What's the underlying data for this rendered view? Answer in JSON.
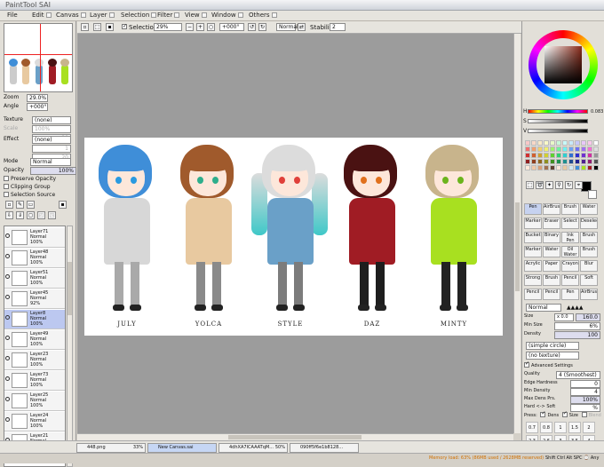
{
  "app": {
    "title": "PaintTool SAI"
  },
  "menu": [
    "File",
    "Edit",
    "Canvas",
    "Layer",
    "Selection",
    "Filter",
    "View",
    "Window",
    "Others"
  ],
  "navigator": {
    "zoom_label": "Zoom",
    "zoom_value": "29.0%",
    "angle_label": "Angle",
    "angle_value": "+000°"
  },
  "texture": {
    "label": "Texture",
    "value": "(none)",
    "scale_label": "Scale",
    "scale_value": "100%",
    "strength": "20"
  },
  "effect": {
    "label": "Effect",
    "value": "(none)",
    "width": "1",
    "strength": "20"
  },
  "layer_props": {
    "mode_label": "Mode",
    "mode_value": "Normal",
    "opacity_label": "Opacity",
    "opacity_value": "100%",
    "preserve": "Preserve Opacity",
    "clipping": "Clipping Group",
    "selection_source": "Selection Source"
  },
  "layers": [
    {
      "name": "Layer71",
      "mode": "Normal",
      "opacity": "100%"
    },
    {
      "name": "Layer48",
      "mode": "Normal",
      "opacity": "100%"
    },
    {
      "name": "Layer51",
      "mode": "Normal",
      "opacity": "100%"
    },
    {
      "name": "Layer45",
      "mode": "Normal",
      "opacity": "92%"
    },
    {
      "name": "Layer8",
      "mode": "Normal",
      "opacity": "100%"
    },
    {
      "name": "Layer49",
      "mode": "Normal",
      "opacity": "100%"
    },
    {
      "name": "Layer23",
      "mode": "Normal",
      "opacity": "100%"
    },
    {
      "name": "Layer73",
      "mode": "Normal",
      "opacity": "100%"
    },
    {
      "name": "Layer25",
      "mode": "Normal",
      "opacity": "100%"
    },
    {
      "name": "Layer24",
      "mode": "Normal",
      "opacity": "100%"
    },
    {
      "name": "Layer21",
      "mode": "Normal",
      "opacity": "100%"
    }
  ],
  "toolbar": {
    "selection_label": "Selection",
    "zoom": "29%",
    "angle": "+000°",
    "blend": "Normal",
    "stabilizer_label": "Stabilizer",
    "stabilizer_value": "2"
  },
  "characters": [
    {
      "name": "JULY",
      "hair": "#3f8ed8",
      "eyes": "#2a9ae0",
      "top": "#d7d7d7",
      "legs": "#a9a9a9"
    },
    {
      "name": "YOLCA",
      "hair": "#a05a2c",
      "eyes": "#2fae8c",
      "top": "#e8c9a0",
      "legs": "#8a8a8a"
    },
    {
      "name": "STYLE",
      "hair": "#dcdcdc",
      "eyes": "#e0403a",
      "top": "#6aa0c8",
      "legs": "#7c7c7c"
    },
    {
      "name": "DAZ",
      "hair": "#4a1212",
      "eyes": "#e0701c",
      "top": "#a01c24",
      "legs": "#1e1e1e"
    },
    {
      "name": "MINTY",
      "hair": "#c8b48c",
      "eyes": "#6cb41c",
      "top": "#a8e020",
      "legs": "#222222"
    }
  ],
  "color": {
    "h_label": "H",
    "s_label": "S",
    "v_label": "V",
    "h_value": "0.083",
    "s_value": "",
    "v_value": "",
    "foreground": "#000000",
    "background": "#ffffff"
  },
  "tools": [
    "Pen",
    "AirBrush",
    "Brush",
    "Water",
    "Marker",
    "Eraser",
    "Select",
    "Deselect",
    "Bucket",
    "Binary",
    "Ink Pen",
    "Brush",
    "Marker",
    "Water",
    "Oil Water",
    "Brush",
    "Acrylic",
    "Paper",
    "Crayon",
    "Blur",
    "Strong",
    "Brush",
    "Pencil",
    "Soft",
    "Pencil",
    "Pencil",
    "Pen",
    "AirBrush"
  ],
  "brush": {
    "mode": "Normal",
    "size_label": "Size",
    "size_mult": "x 0.0",
    "size_value": "160.0",
    "minsize_label": "Min Size",
    "minsize_value": "6%",
    "density_label": "Density",
    "density_value": "100",
    "shape": "(simple circle)",
    "texture": "(no texture)",
    "advanced_label": "Advanced Settings",
    "quality_label": "Quality",
    "quality_value": "4 (Smoothest)",
    "edge_label": "Edge Hardness",
    "edge_value": "0",
    "mindens_label": "Min Density",
    "mindens_value": "4",
    "maxdens_label": "Max Dens Prs.",
    "maxdens_value": "100%",
    "hardsoft_label": "Hard <-> Soft",
    "hardsoft_value": "%",
    "pressure_label": "Press:",
    "dens_label": "Dens",
    "size2_label": "Size",
    "blend_label": "Blend",
    "sizes": [
      "0.7",
      "0.8",
      "1",
      "1.5",
      "2",
      "2.3",
      "2.6",
      "3",
      "3.5",
      "4"
    ]
  },
  "tasks": [
    {
      "name": "448.png",
      "percent": "33%"
    },
    {
      "name": "New Canvas.sai",
      "percent": ""
    },
    {
      "name": "4dhXA7ICAAATqM...",
      "percent": "50%"
    },
    {
      "name": "090ff5f6e1b8128...",
      "percent": ""
    }
  ],
  "status": {
    "memory": "Memory load: 63% (86MB used / 2628MB reserved)",
    "keys": "Shift Ctrl Alt SPC ⌚ Any"
  }
}
